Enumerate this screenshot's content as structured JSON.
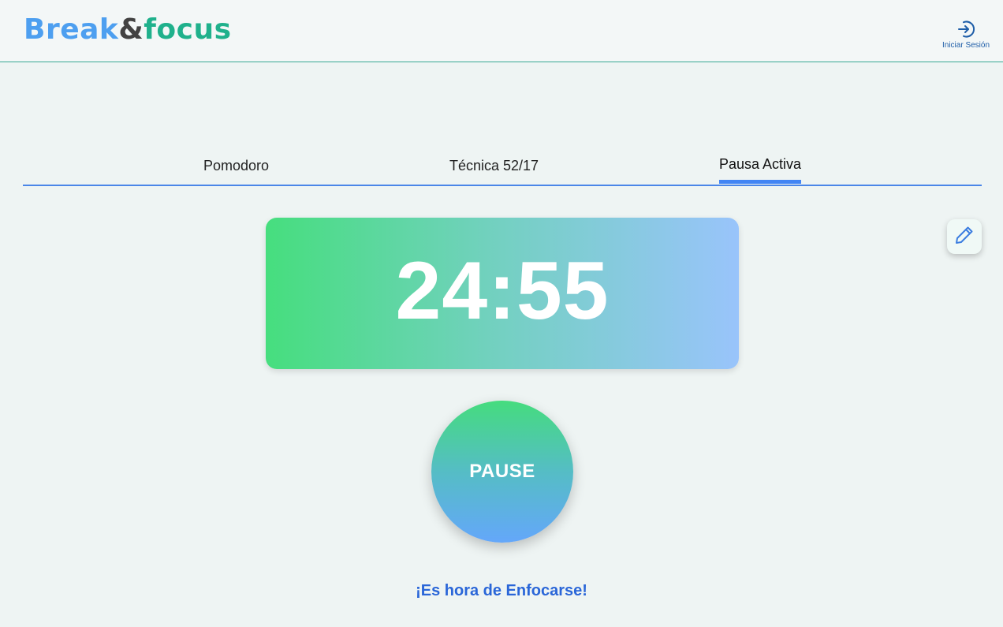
{
  "header": {
    "logo": {
      "part1": "Break",
      "part2": "&",
      "part3": "focus"
    },
    "login_label": "Iniciar Sesión",
    "login_icon": "login-icon"
  },
  "tabs": [
    {
      "label": "Pomodoro",
      "active": false
    },
    {
      "label": "Técnica 52/17",
      "active": false
    },
    {
      "label": "Pausa Activa",
      "active": true
    }
  ],
  "edit_button": {
    "icon": "pencil-icon"
  },
  "timer": {
    "value": "24:55"
  },
  "controls": {
    "pause_label": "PAUSE"
  },
  "message": "¡Es hora de Enfocarse!",
  "colors": {
    "accent_blue": "#4285f4",
    "brand_blue": "#4d9ff0",
    "brand_green": "#1fb18c",
    "timer_gradient_start": "#46de7e",
    "timer_gradient_end": "#99c4fb",
    "message_color": "#2a66d8"
  }
}
